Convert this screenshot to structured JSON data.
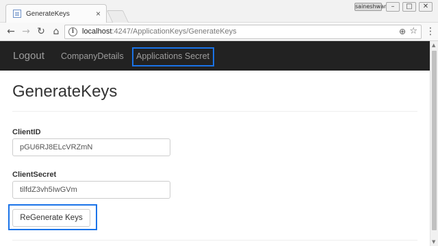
{
  "browser": {
    "tab_title": "GenerateKeys",
    "tab_close": "×",
    "user_name": "saineshwar",
    "window_controls": {
      "minimize": "–",
      "maximize": "□",
      "close": "✕"
    },
    "nav_glyphs": {
      "back": "←",
      "forward": "→",
      "reload": "↻",
      "home": "⌂"
    },
    "url_host": "localhost",
    "url_path": ":4247/ApplicationKeys/GenerateKeys",
    "info_glyph": "i",
    "zoom_glyph": "⊕",
    "star_glyph": "☆",
    "menu_glyph": "⋮",
    "icons": [
      "page-favicon-icon",
      "back-arrow-icon",
      "forward-arrow-icon",
      "reload-icon",
      "home-icon",
      "info-icon",
      "zoom-icon",
      "bookmark-star-icon",
      "menu-dots-icon"
    ]
  },
  "navbar": {
    "brand": "Logout",
    "links": [
      "CompanyDetails",
      "Applications Secret"
    ]
  },
  "page": {
    "title": "GenerateKeys",
    "client_id_label": "ClientID",
    "client_id_value": "pGU6RJ8ELcVRZmN",
    "client_secret_label": "ClientSecret",
    "client_secret_value": "tilfdZ3vh5IwGVm",
    "regenerate_button": "ReGenerate Keys"
  },
  "scrollbar": {
    "up_glyph": "▲",
    "down_glyph": "▼"
  },
  "colors": {
    "navbar_bg": "#222222",
    "navbar_text": "#9d9d9d",
    "highlight_border": "#1a73e8",
    "page_bg": "#ffffff"
  }
}
